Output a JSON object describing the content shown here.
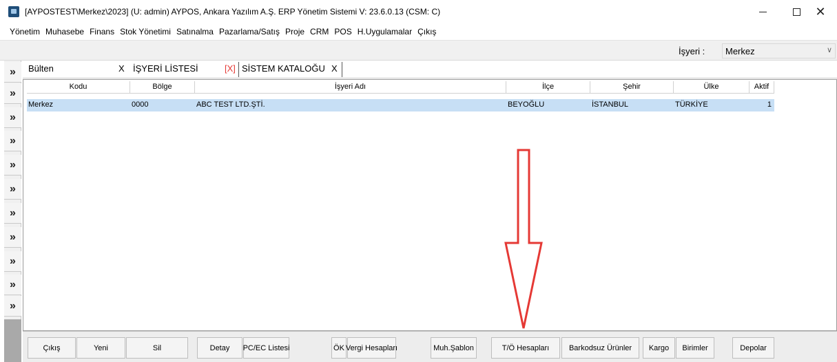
{
  "window": {
    "title": "[AYPOSTEST\\Merkez\\2023] (U: admin) AYPOS, Ankara Yazılım A.Ş. ERP Yönetim Sistemi V: 23.6.0.13 (CSM: C)",
    "minimize_label": "—",
    "maximize_label": "☐",
    "close_label": "✕"
  },
  "menu": {
    "items": [
      "Yönetim",
      "Muhasebe",
      "Finans",
      "Stok Yönetimi",
      "Satınalma",
      "Pazarlama/Satış",
      "Proje",
      "CRM",
      "POS",
      "H.Uygulamalar",
      "Çıkış"
    ]
  },
  "toolbar": {
    "isyeri_label": "İşyeri :",
    "isyeri_value": "Merkez"
  },
  "sidebar": {
    "button_glyph": "»"
  },
  "tabs": [
    {
      "label": "Bülten",
      "close": "X"
    },
    {
      "label": "İŞYERİ LİSTESİ",
      "close": "[X]"
    },
    {
      "label": "SİSTEM KATALOĞU",
      "close": "X"
    }
  ],
  "grid": {
    "columns": [
      "Kodu",
      "Bölge",
      "İşyeri Adı",
      "İlçe",
      "Şehir",
      "Ülke",
      "Aktif"
    ],
    "rows": [
      [
        "Merkez",
        "0000",
        "ABC TEST LTD.ŞTİ.",
        "BEYOĞLU",
        "İSTANBUL",
        "TÜRKİYE",
        "1"
      ]
    ]
  },
  "buttons": [
    "Çıkış",
    "Yeni",
    "Sil",
    "Detay",
    "PC/EC Listesi",
    "ÖK",
    "Vergi Hesapları",
    "Muh.Şablon",
    "T/Ö Hesapları",
    "Barkodsuz Ürünler",
    "Kargo",
    "Birimler",
    "Depolar"
  ],
  "colors": {
    "arrow": "#e53935",
    "selected_row": "#c7dff5"
  }
}
